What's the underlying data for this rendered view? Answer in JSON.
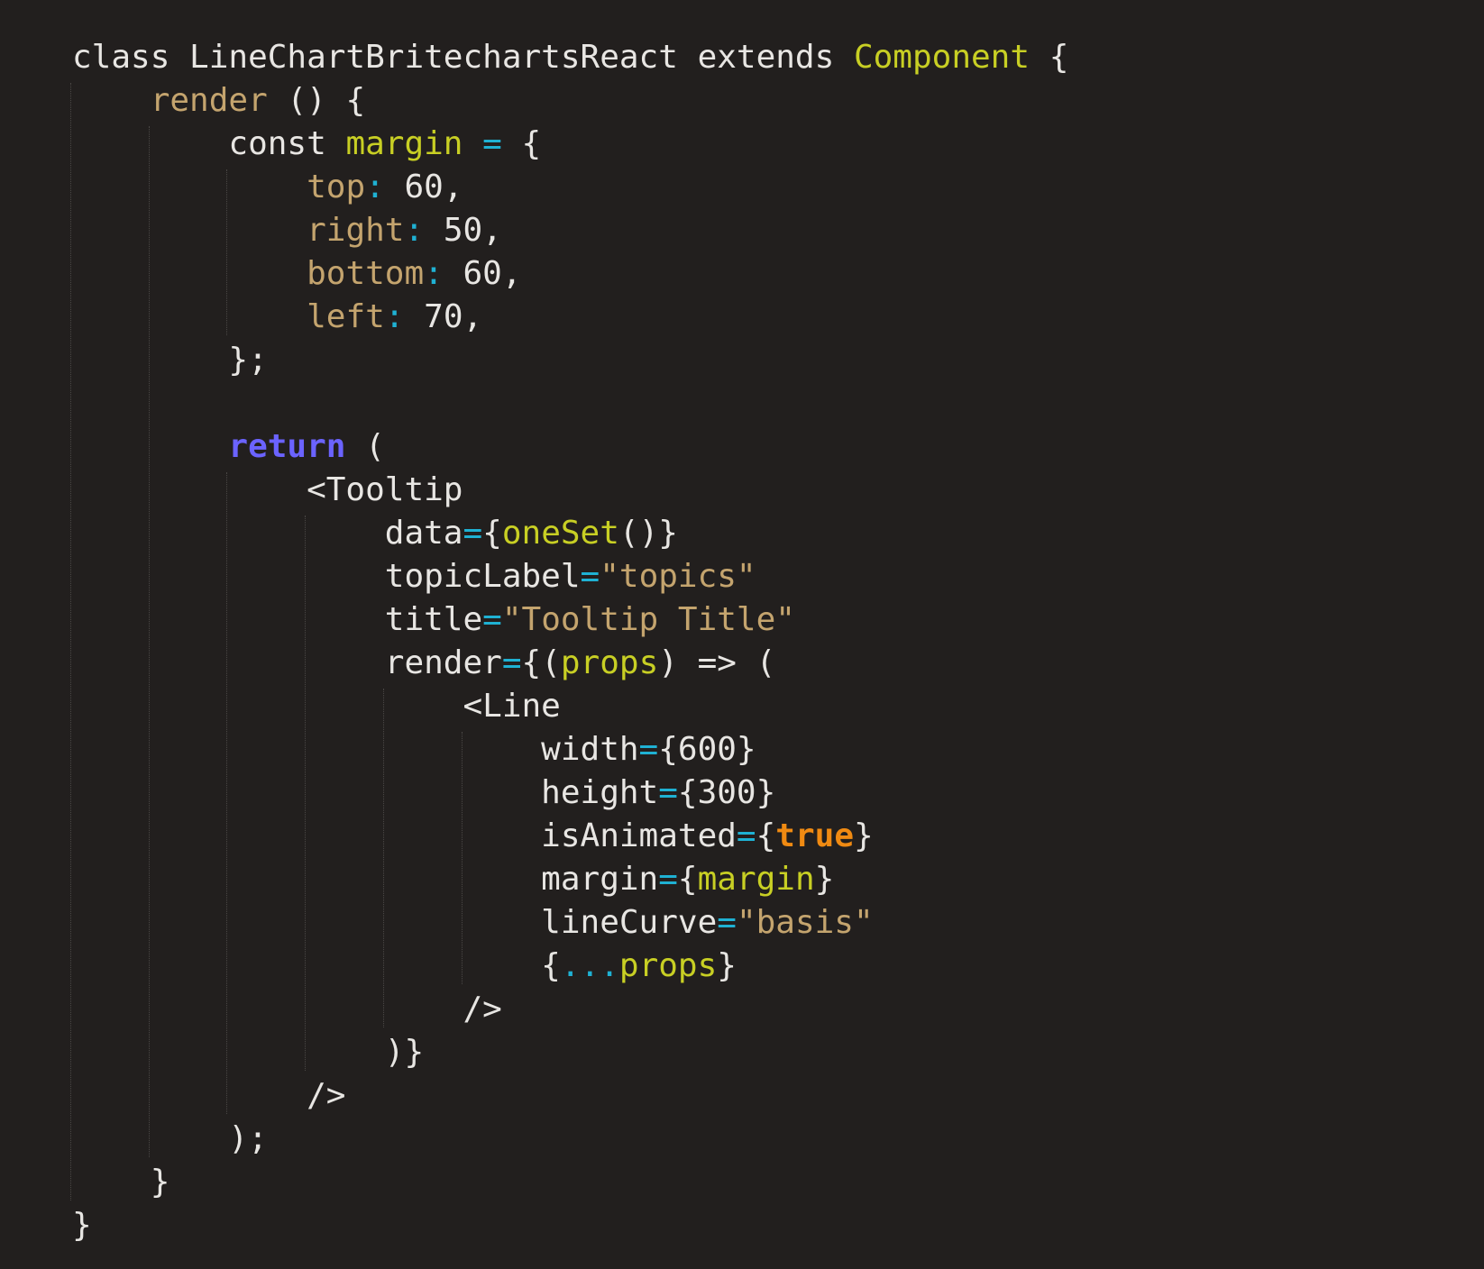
{
  "editor": {
    "theme": {
      "background": "#221f1e",
      "plain": "#e8e6e3",
      "keyword": "#e8e6e3",
      "function_name": "#c4a46e",
      "class_name": "#c8cf24",
      "property": "#c4a46e",
      "operator": "#1fb1d3",
      "number": "#e8e6e3",
      "string": "#c4a46e",
      "return_keyword": "#6b63ff",
      "boolean": "#f08a12",
      "indent_guide": "#4a4745"
    },
    "lines": [
      [
        {
          "t": "class LineChartBritechartsReact extends ",
          "c": "plain"
        },
        {
          "t": "Component",
          "c": "class_name"
        },
        {
          "t": " {",
          "c": "plain"
        }
      ],
      [
        {
          "t": "    ",
          "c": "plain"
        },
        {
          "t": "render",
          "c": "function_name"
        },
        {
          "t": " () {",
          "c": "plain"
        }
      ],
      [
        {
          "t": "        const ",
          "c": "plain"
        },
        {
          "t": "margin",
          "c": "class_name"
        },
        {
          "t": " ",
          "c": "plain"
        },
        {
          "t": "=",
          "c": "operator"
        },
        {
          "t": " {",
          "c": "plain"
        }
      ],
      [
        {
          "t": "            ",
          "c": "plain"
        },
        {
          "t": "top",
          "c": "property"
        },
        {
          "t": ":",
          "c": "operator"
        },
        {
          "t": " 60,",
          "c": "plain"
        }
      ],
      [
        {
          "t": "            ",
          "c": "plain"
        },
        {
          "t": "right",
          "c": "property"
        },
        {
          "t": ":",
          "c": "operator"
        },
        {
          "t": " 50,",
          "c": "plain"
        }
      ],
      [
        {
          "t": "            ",
          "c": "plain"
        },
        {
          "t": "bottom",
          "c": "property"
        },
        {
          "t": ":",
          "c": "operator"
        },
        {
          "t": " 60,",
          "c": "plain"
        }
      ],
      [
        {
          "t": "            ",
          "c": "plain"
        },
        {
          "t": "left",
          "c": "property"
        },
        {
          "t": ":",
          "c": "operator"
        },
        {
          "t": " 70,",
          "c": "plain"
        }
      ],
      [
        {
          "t": "        };",
          "c": "plain"
        }
      ],
      [
        {
          "t": "",
          "c": "plain"
        }
      ],
      [
        {
          "t": "        ",
          "c": "plain"
        },
        {
          "t": "return",
          "c": "return_keyword",
          "b": true
        },
        {
          "t": " (",
          "c": "plain"
        }
      ],
      [
        {
          "t": "            <Tooltip",
          "c": "plain"
        }
      ],
      [
        {
          "t": "                data",
          "c": "plain"
        },
        {
          "t": "=",
          "c": "operator"
        },
        {
          "t": "{",
          "c": "plain"
        },
        {
          "t": "oneSet",
          "c": "class_name"
        },
        {
          "t": "()}",
          "c": "plain"
        }
      ],
      [
        {
          "t": "                topicLabel",
          "c": "plain"
        },
        {
          "t": "=",
          "c": "operator"
        },
        {
          "t": "\"topics\"",
          "c": "string"
        }
      ],
      [
        {
          "t": "                title",
          "c": "plain"
        },
        {
          "t": "=",
          "c": "operator"
        },
        {
          "t": "\"Tooltip Title\"",
          "c": "string"
        }
      ],
      [
        {
          "t": "                render",
          "c": "plain"
        },
        {
          "t": "=",
          "c": "operator"
        },
        {
          "t": "{(",
          "c": "plain"
        },
        {
          "t": "props",
          "c": "class_name"
        },
        {
          "t": ") => (",
          "c": "plain"
        }
      ],
      [
        {
          "t": "                    <Line",
          "c": "plain"
        }
      ],
      [
        {
          "t": "                        width",
          "c": "plain"
        },
        {
          "t": "=",
          "c": "operator"
        },
        {
          "t": "{600}",
          "c": "plain"
        }
      ],
      [
        {
          "t": "                        height",
          "c": "plain"
        },
        {
          "t": "=",
          "c": "operator"
        },
        {
          "t": "{300}",
          "c": "plain"
        }
      ],
      [
        {
          "t": "                        isAnimated",
          "c": "plain"
        },
        {
          "t": "=",
          "c": "operator"
        },
        {
          "t": "{",
          "c": "plain"
        },
        {
          "t": "true",
          "c": "boolean",
          "b": true
        },
        {
          "t": "}",
          "c": "plain"
        }
      ],
      [
        {
          "t": "                        margin",
          "c": "plain"
        },
        {
          "t": "=",
          "c": "operator"
        },
        {
          "t": "{",
          "c": "plain"
        },
        {
          "t": "margin",
          "c": "class_name"
        },
        {
          "t": "}",
          "c": "plain"
        }
      ],
      [
        {
          "t": "                        lineCurve",
          "c": "plain"
        },
        {
          "t": "=",
          "c": "operator"
        },
        {
          "t": "\"basis\"",
          "c": "string"
        }
      ],
      [
        {
          "t": "                        {",
          "c": "plain"
        },
        {
          "t": "...",
          "c": "operator"
        },
        {
          "t": "props",
          "c": "class_name"
        },
        {
          "t": "}",
          "c": "plain"
        }
      ],
      [
        {
          "t": "                    />",
          "c": "plain"
        }
      ],
      [
        {
          "t": "                )}",
          "c": "plain"
        }
      ],
      [
        {
          "t": "            />",
          "c": "plain"
        }
      ],
      [
        {
          "t": "        );",
          "c": "plain"
        }
      ],
      [
        {
          "t": "    }",
          "c": "plain"
        }
      ],
      [
        {
          "t": "}",
          "c": "plain"
        }
      ]
    ]
  }
}
